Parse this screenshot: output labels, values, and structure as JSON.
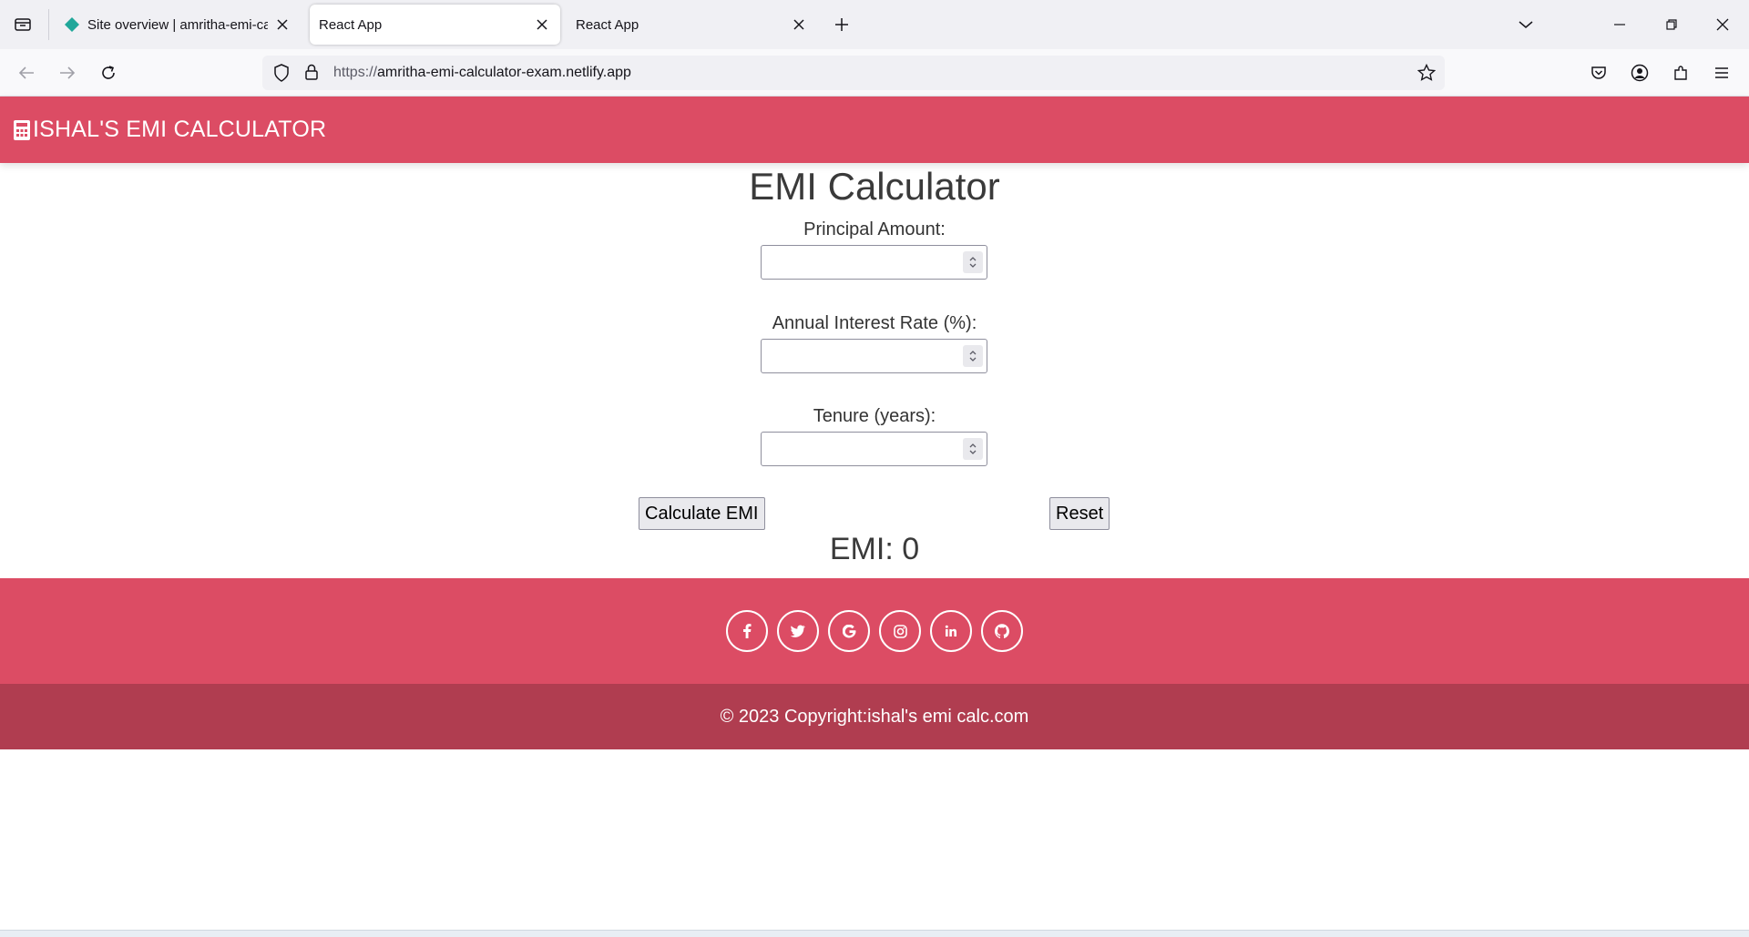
{
  "browser": {
    "tabs": [
      {
        "title": "Site overview | amritha-emi-calculator-exam",
        "active": false
      },
      {
        "title": "React App",
        "active": true
      },
      {
        "title": "React App",
        "active": false
      }
    ],
    "url": {
      "scheme": "https://",
      "host": "amritha-emi-calculator-exam.netlify.app"
    }
  },
  "app": {
    "brand": "ISHAL'S EMI CALCULATOR",
    "title": "EMI Calculator",
    "fields": [
      {
        "label": "Principal Amount:",
        "value": ""
      },
      {
        "label": "Annual Interest Rate (%):",
        "value": ""
      },
      {
        "label": "Tenure (years):",
        "value": ""
      }
    ],
    "calculate_label": "Calculate EMI",
    "reset_label": "Reset",
    "result": "EMI: 0",
    "social": [
      {
        "icon": "facebook-icon",
        "glyph": "f"
      },
      {
        "icon": "twitter-icon",
        "glyph": "t"
      },
      {
        "icon": "google-icon",
        "glyph": "G"
      },
      {
        "icon": "instagram-icon",
        "glyph": "◎"
      },
      {
        "icon": "linkedin-icon",
        "glyph": "in"
      },
      {
        "icon": "github-icon",
        "glyph": "⌂"
      }
    ],
    "copyright": "© 2023 Copyright:ishal's emi calc.com",
    "colors": {
      "primary": "#dc4c64",
      "footer_dark": "#b03d50"
    }
  }
}
